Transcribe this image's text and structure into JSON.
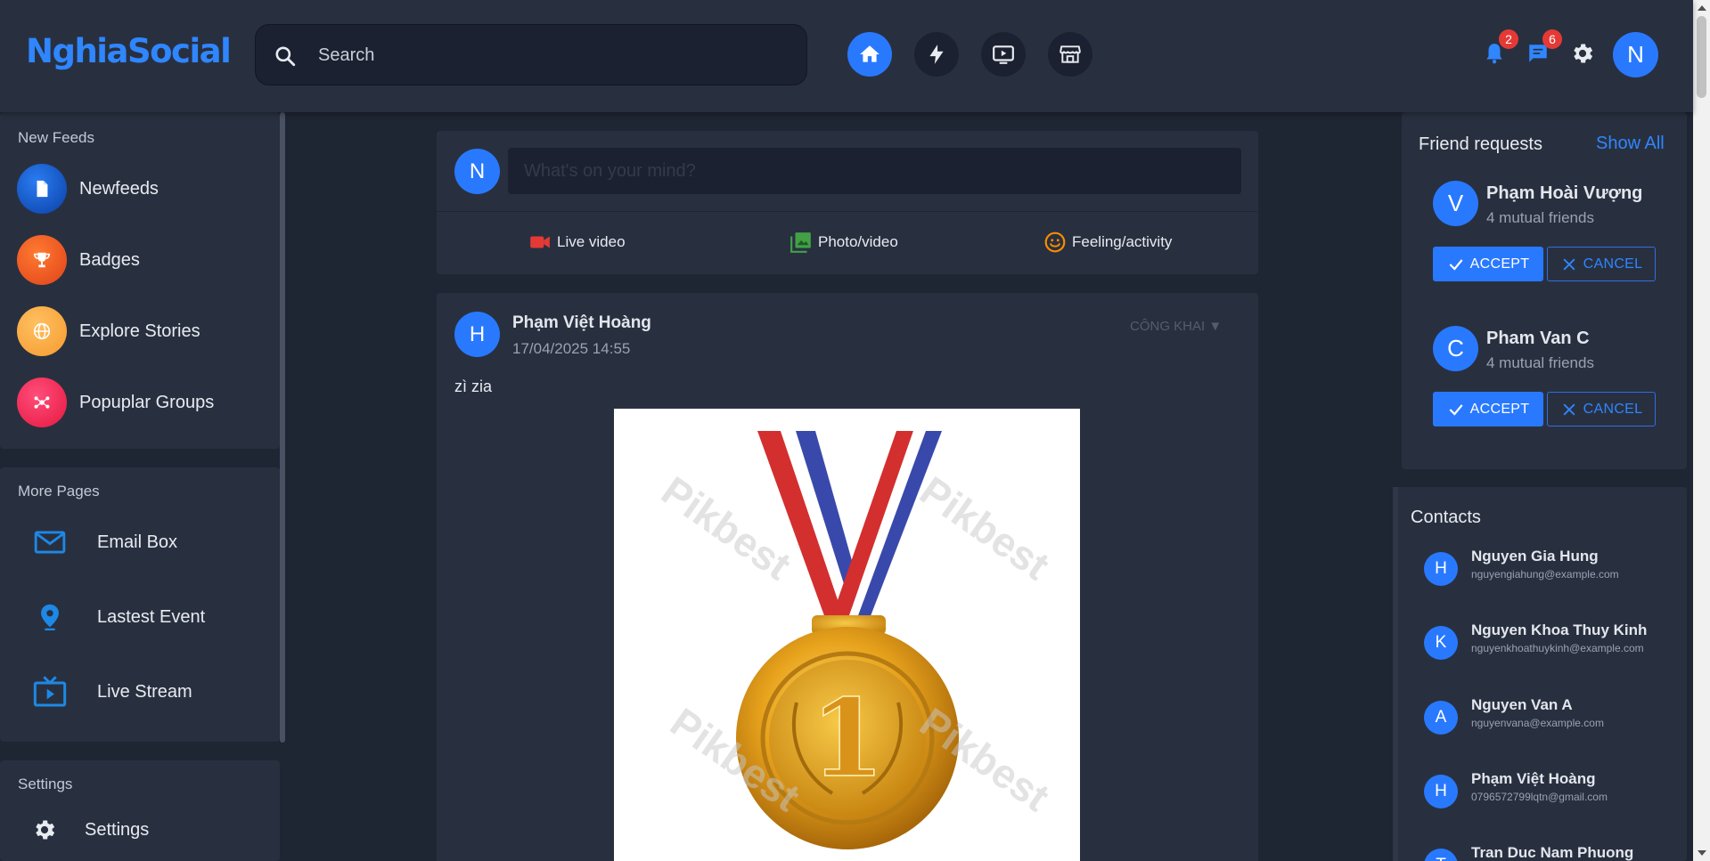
{
  "header": {
    "logo": "NghiaSocial",
    "search_placeholder": "Search",
    "notification_count": "2",
    "message_count": "6",
    "user_initial": "N"
  },
  "sidebar": {
    "feeds_title": "New Feeds",
    "feeds": [
      {
        "label": "Newfeeds",
        "icon": "document-icon"
      },
      {
        "label": "Badges",
        "icon": "trophy-icon"
      },
      {
        "label": "Explore Stories",
        "icon": "globe-icon"
      },
      {
        "label": "Popuplar Groups",
        "icon": "groups-icon"
      }
    ],
    "pages_title": "More Pages",
    "pages": [
      {
        "label": "Email Box",
        "icon": "mail-icon"
      },
      {
        "label": "Lastest Event",
        "icon": "location-pin-icon"
      },
      {
        "label": "Live Stream",
        "icon": "live-tv-icon"
      }
    ],
    "settings_title": "Settings",
    "settings_item": "Settings"
  },
  "composer": {
    "avatar_initial": "N",
    "placeholder": "What's on your mind?",
    "actions": [
      "Live video",
      "Photo/video",
      "Feeling/activity"
    ]
  },
  "post": {
    "avatar_initial": "H",
    "author": "Phạm Việt Hoàng",
    "timestamp": "17/04/2025 14:55",
    "privacy": "CÔNG KHAI ▼",
    "content": "zì zia",
    "image_digit": "1",
    "watermark": "Pikbest"
  },
  "friend_requests": {
    "title": "Friend requests",
    "show_all": "Show All",
    "accept_label": "ACCEPT",
    "cancel_label": "CANCEL",
    "items": [
      {
        "initial": "V",
        "name": "Phạm Hoài Vượng",
        "mutual": "4 mutual friends"
      },
      {
        "initial": "C",
        "name": "Pham Van C",
        "mutual": "4 mutual friends"
      }
    ]
  },
  "contacts": {
    "title": "Contacts",
    "items": [
      {
        "initial": "H",
        "name": "Nguyen Gia Hung",
        "email": "nguyengiahung@example.com"
      },
      {
        "initial": "K",
        "name": "Nguyen Khoa Thuy Kinh",
        "email": "nguyenkhoathuykinh@example.com"
      },
      {
        "initial": "A",
        "name": "Nguyen Van A",
        "email": "nguyenvana@example.com"
      },
      {
        "initial": "H",
        "name": "Phạm Việt Hoàng",
        "email": "0796572799lqtn@gmail.com"
      },
      {
        "initial": "T",
        "name": "Tran Duc Nam Phuong",
        "email": ""
      }
    ]
  },
  "colors": {
    "accent": "#2979ff",
    "background": "#1e2533",
    "panel": "#283040",
    "badge": "#e53935"
  }
}
